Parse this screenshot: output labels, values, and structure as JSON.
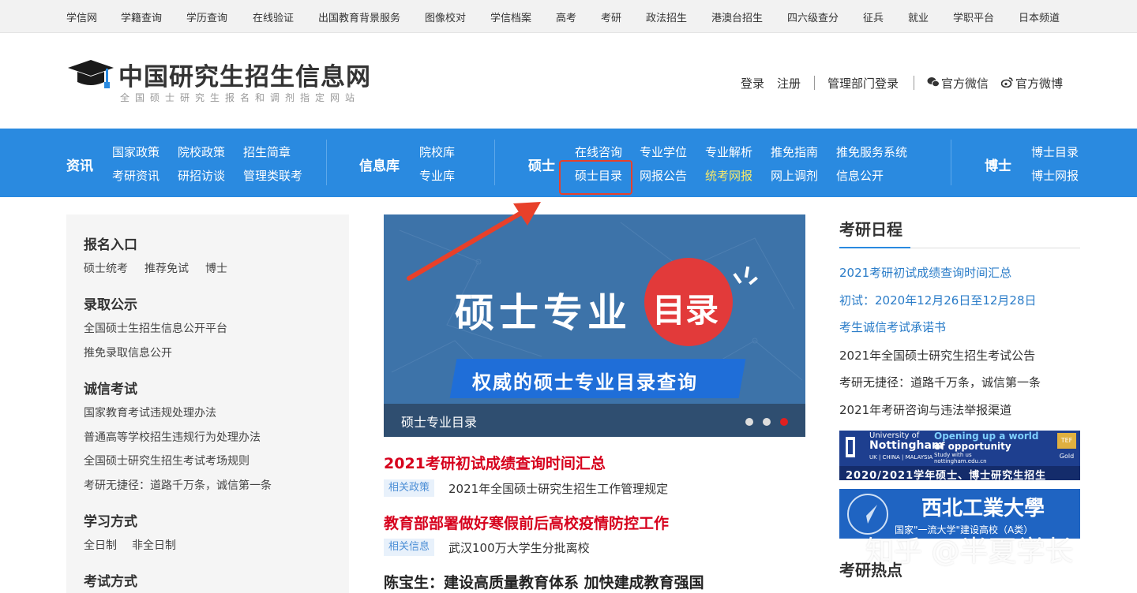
{
  "topbar": [
    "学信网",
    "学籍查询",
    "学历查询",
    "在线验证",
    "出国教育背景服务",
    "图像校对",
    "学信档案",
    "高考",
    "考研",
    "政法招生",
    "港澳台招生",
    "四六级查分",
    "征兵",
    "就业",
    "学职平台",
    "日本频道"
  ],
  "header": {
    "title": "中国研究生招生信息网",
    "subtitle": "全国硕士研究生报名和调剂指定网站",
    "login": "登录",
    "register": "注册",
    "admin_login": "管理部门登录",
    "wechat": "官方微信",
    "weibo": "官方微博"
  },
  "nav": {
    "news": {
      "label": "资讯",
      "row1": [
        "国家政策",
        "院校政策",
        "招生简章"
      ],
      "row2": [
        "考研资讯",
        "研招访谈",
        "管理类联考"
      ]
    },
    "info": {
      "label": "信息库",
      "row1": [
        "院校库"
      ],
      "row2": [
        "专业库"
      ]
    },
    "master": {
      "label": "硕士",
      "row1": [
        "在线咨询",
        "专业学位",
        "专业解析",
        "推免指南",
        "推免服务系统"
      ],
      "row2": [
        "硕士目录",
        "网报公告",
        "统考网报",
        "网上调剂",
        "信息公开"
      ]
    },
    "phd": {
      "label": "博士",
      "row1": [
        "博士目录"
      ],
      "row2": [
        "博士网报"
      ]
    }
  },
  "left": {
    "s1": {
      "title": "报名入口",
      "links": [
        "硕士统考",
        "推荐免试",
        "博士"
      ]
    },
    "s2": {
      "title": "录取公示",
      "links": [
        "全国硕士生招生信息公开平台",
        "推免录取信息公开"
      ]
    },
    "s3": {
      "title": "诚信考试",
      "links": [
        "国家教育考试违规处理办法",
        "普通高等学校招生违规行为处理办法",
        "全国硕士研究生招生考试考场规则",
        "考研无捷径：道路千万条，诚信第一条"
      ]
    },
    "s4": {
      "title": "学习方式",
      "links": [
        "全日制",
        "非全日制"
      ]
    },
    "s5": {
      "title": "考试方式"
    }
  },
  "banner": {
    "headline": "硕士专业",
    "circle": "目录",
    "ribbon": "权威的硕士专业目录查询",
    "caption": "硕士专业目录"
  },
  "news": [
    {
      "title": "2021考研初试成绩查询时间汇总",
      "tag": "相关政策",
      "sub": "2021年全国硕士研究生招生工作管理规定"
    },
    {
      "title": "教育部部署做好寒假前后高校疫情防控工作",
      "tag": "相关信息",
      "sub": "武汉100万大学生分批离校"
    },
    {
      "title": "陈宝生：建设高质量教育体系 加快建成教育强国"
    }
  ],
  "right": {
    "schedule_title": "考研日程",
    "items": [
      "2021考研初试成绩查询时间汇总",
      "初试：2020年12月26日至12月28日",
      "考生诚信考试承诺书",
      "2021年全国硕士研究生招生考试公告",
      "考研无捷径：道路千万条，诚信第一条",
      "2021年考研咨询与违法举报渠道"
    ],
    "ad1": {
      "l1": "University of",
      "l2": "Nottingham",
      "l3": "UK | CHINA | MALAYSIA",
      "tag1": "Opening up a world",
      "tag2": "of opportunity",
      "tag3": "Study with us",
      "tag4": "nottingham.edu.cn",
      "tef": "TEF Gold",
      "bottom": "2020/2021学年硕士、博士研究生招生"
    },
    "ad2": {
      "name": "西北工業大學",
      "sub": "国家\"一流大学\"建设高校（A类）"
    },
    "hot_title": "考研热点"
  },
  "watermark": "知乎 @半夏学长",
  "colors": {
    "nav_blue": "#2a8ae0",
    "highlight_red": "#e8402a",
    "news_red": "#d6001c",
    "link_blue": "#2a7cc8"
  }
}
